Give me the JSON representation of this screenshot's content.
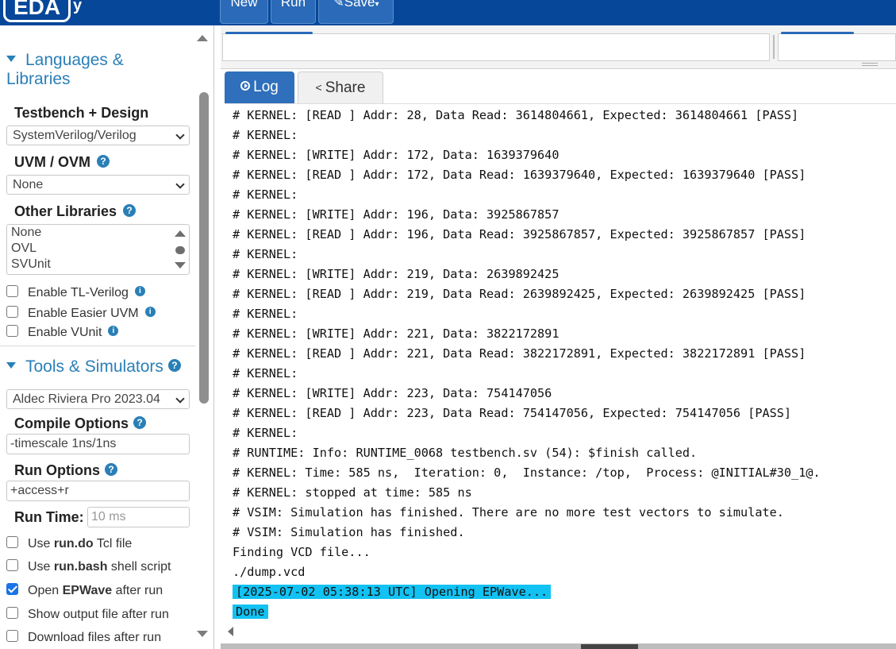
{
  "topbar": {
    "logo": "EDA",
    "logo_tail": "y",
    "buttons": {
      "new": "New",
      "run": "Run",
      "save": "Save"
    }
  },
  "sidebar": {
    "languages_title": "Languages & Libraries",
    "testbench_label": "Testbench + Design",
    "testbench_value": "SystemVerilog/Verilog",
    "uvm_label": "UVM / OVM",
    "uvm_value": "None",
    "other_libs_label": "Other Libraries",
    "other_libs_options": [
      "None",
      "OVL",
      "SVUnit"
    ],
    "checks1": [
      {
        "label": "Enable TL-Verilog",
        "checked": false
      },
      {
        "label": "Enable Easier UVM",
        "checked": false
      },
      {
        "label": "Enable VUnit",
        "checked": false
      }
    ],
    "tools_title": "Tools & Simulators",
    "simulator_value": "Aldec Riviera Pro 2023.04",
    "compile_label": "Compile Options",
    "compile_value": "-timescale 1ns/1ns",
    "run_opts_label": "Run Options",
    "run_opts_value": "+access+r",
    "run_time_label": "Run Time:",
    "run_time_placeholder": "10 ms",
    "checks2": [
      {
        "pre": "Use ",
        "bold": "run.do",
        "post": " Tcl file",
        "checked": false
      },
      {
        "pre": "Use ",
        "bold": "run.bash",
        "post": " shell script",
        "checked": false
      },
      {
        "pre": "Open ",
        "bold": "EPWave",
        "post": " after run",
        "checked": true
      },
      {
        "pre": "Show output file after run",
        "bold": "",
        "post": "",
        "checked": false
      },
      {
        "pre": "Download files after run",
        "bold": "",
        "post": "",
        "checked": false
      }
    ]
  },
  "tabs": {
    "log": "Log",
    "share": "Share"
  },
  "log_lines": [
    "# KERNEL: [READ ] Addr: 28, Data Read: 3614804661, Expected: 3614804661 [PASS]",
    "# KERNEL:",
    "# KERNEL: [WRITE] Addr: 172, Data: 1639379640",
    "# KERNEL: [READ ] Addr: 172, Data Read: 1639379640, Expected: 1639379640 [PASS]",
    "# KERNEL:",
    "# KERNEL: [WRITE] Addr: 196, Data: 3925867857",
    "# KERNEL: [READ ] Addr: 196, Data Read: 3925867857, Expected: 3925867857 [PASS]",
    "# KERNEL:",
    "# KERNEL: [WRITE] Addr: 219, Data: 2639892425",
    "# KERNEL: [READ ] Addr: 219, Data Read: 2639892425, Expected: 2639892425 [PASS]",
    "# KERNEL:",
    "# KERNEL: [WRITE] Addr: 221, Data: 3822172891",
    "# KERNEL: [READ ] Addr: 221, Data Read: 3822172891, Expected: 3822172891 [PASS]",
    "# KERNEL:",
    "# KERNEL: [WRITE] Addr: 223, Data: 754147056",
    "# KERNEL: [READ ] Addr: 223, Data Read: 754147056, Expected: 754147056 [PASS]",
    "# KERNEL:",
    "# RUNTIME: Info: RUNTIME_0068 testbench.sv (54): $finish called.",
    "# KERNEL: Time: 585 ns,  Iteration: 0,  Instance: /top,  Process: @INITIAL#30_1@.",
    "# KERNEL: stopped at time: 585 ns",
    "# VSIM: Simulation has finished. There are no more test vectors to simulate.",
    "# VSIM: Simulation has finished.",
    "Finding VCD file...",
    "./dump.vcd"
  ],
  "log_highlight": [
    "[2025-07-02 05:38:13 UTC] Opening EPWave...",
    "Done"
  ],
  "colors": {
    "brand": "#06479a",
    "accent": "#2a7fb7",
    "highlight": "#12c2f3"
  }
}
